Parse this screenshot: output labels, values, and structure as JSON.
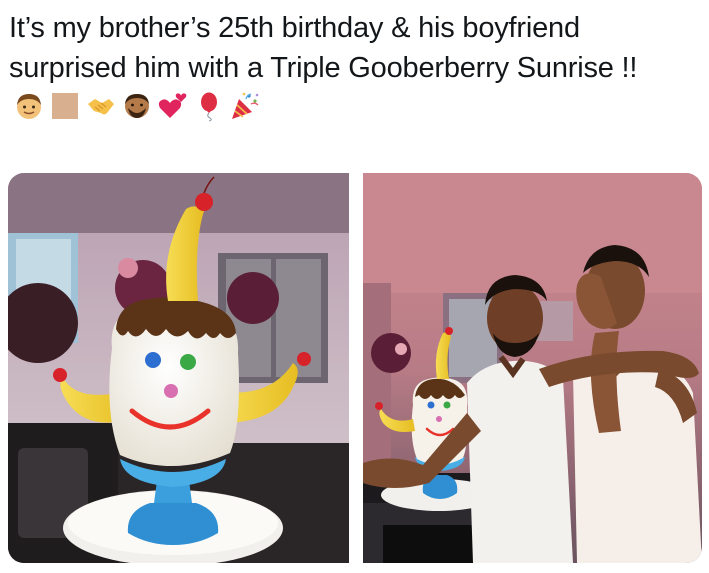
{
  "tweet": {
    "text": "It’s my brother’s 25th birthday & his boyfriend surprised him with a Triple Gooberberry Sunrise !!",
    "emojis": [
      "man-icon",
      "skin-tone-swatch-icon",
      "handshake-icon",
      "man-beard-icon",
      "hearts-icon",
      "balloon-icon",
      "party-popper-icon"
    ]
  },
  "photos": [
    {
      "name": "cake-closeup-photo"
    },
    {
      "name": "couple-with-cake-photo"
    }
  ],
  "colors": {
    "text": "#14171a",
    "cake_white": "#f4f1e8",
    "cake_blue": "#3a9fdc",
    "banana_yellow": "#f3d23a",
    "chocolate": "#5b3418",
    "cherry_red": "#d8222a",
    "smile_red": "#e8322a"
  }
}
